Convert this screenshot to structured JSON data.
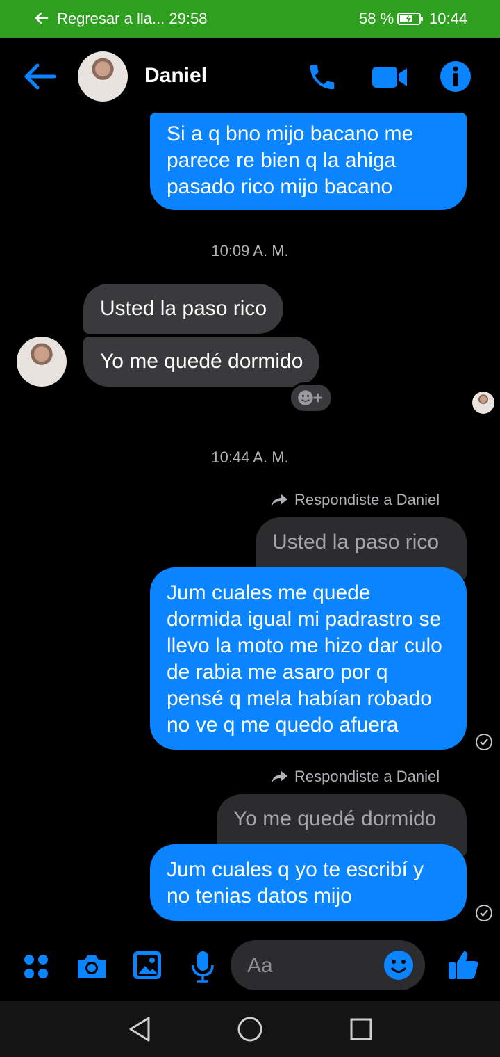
{
  "status_bar": {
    "call_banner": "Regresar a lla...  29:58",
    "battery": "58 %",
    "time": "10:44"
  },
  "header": {
    "contact_name": "Daniel"
  },
  "messages": {
    "out_top": "Si a q bno mijo bacano me parece re bien q la ahiga pasado rico mijo bacano",
    "timestamp_1": "10:09 A. M.",
    "in_1": "Usted la paso rico",
    "in_2": "Yo me quedé dormido",
    "timestamp_2": "10:44 A. M.",
    "reply_note_1": "Respondiste a Daniel",
    "quote_1": "Usted la paso rico",
    "out_2": "Jum cuales me quede dormida igual mi padrastro se llevo la moto me hizo dar culo de rabia me asaro por q pensé q mela habían robado no ve q me quedo afuera",
    "reply_note_2": "Respondiste a Daniel",
    "quote_2": "Yo me quedé dormido",
    "out_3": "Jum cuales q yo te escribí y no tenias datos mijo"
  },
  "composer": {
    "placeholder": "Aa"
  },
  "colors": {
    "accent": "#0a84ff",
    "status_green": "#2e9f1e",
    "incoming_bubble": "#3a3a3c"
  }
}
